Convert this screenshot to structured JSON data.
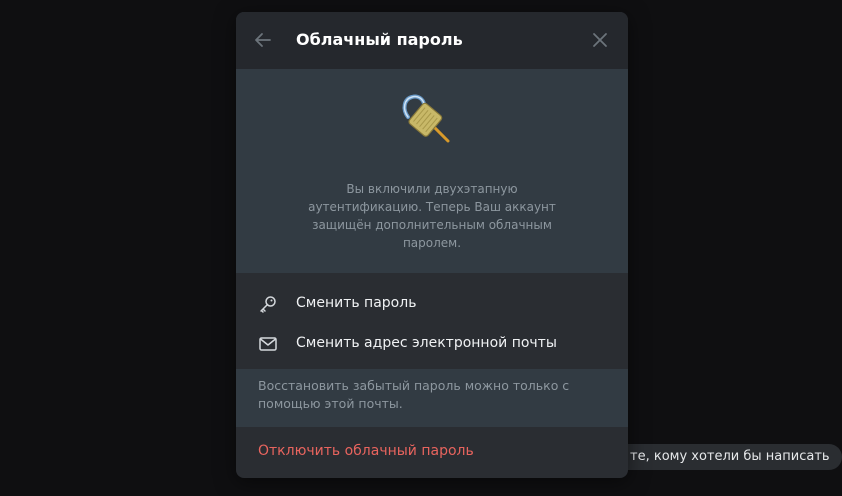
{
  "background_hint": {
    "text": "те, кому хотели бы написать"
  },
  "dialog": {
    "title": "Облачный пароль",
    "back_icon": "arrow-left-icon",
    "close_icon": "close-icon",
    "hero_icon": "padlock-icon",
    "hero_text": "Вы включили двухэтапную аутентификацию. Теперь Ваш аккаунт защищён дополнительным облачным паролем.",
    "menu": [
      {
        "label": "Сменить пароль",
        "icon": "key-icon"
      },
      {
        "label": "Сменить адрес электронной почты",
        "icon": "envelope-icon"
      }
    ],
    "note": "Восстановить забытый пароль можно только с помощью этой почты.",
    "disable_label": "Отключить облачный пароль"
  },
  "colors": {
    "backdrop": "#0f0f11",
    "dialog_bg": "#2a2d32",
    "section_bg": "#323b43",
    "danger": "#e8645e",
    "muted_text": "#8d979f"
  }
}
